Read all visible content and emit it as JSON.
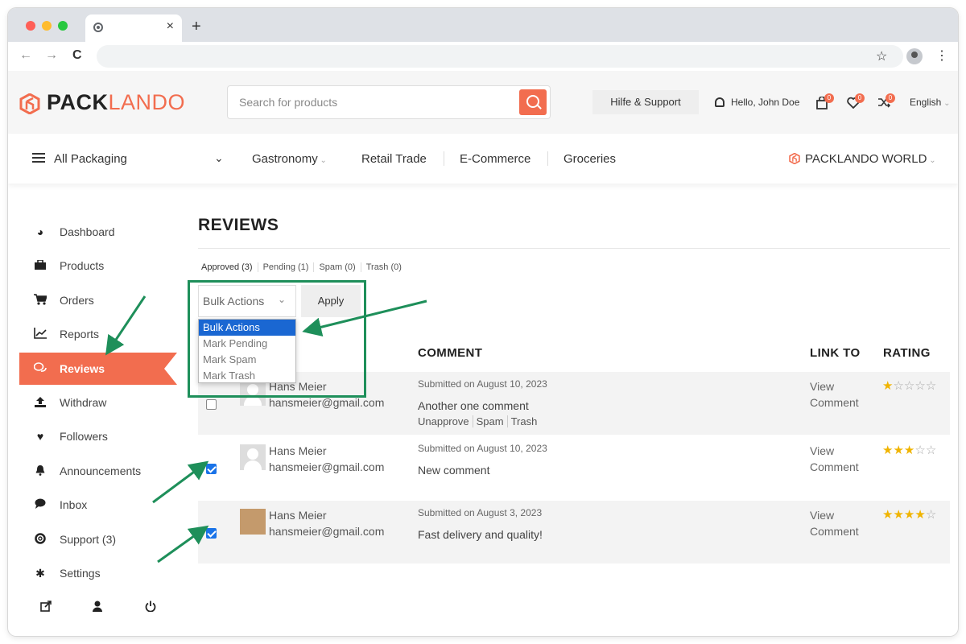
{
  "browser": {
    "tab_close": "×",
    "new_tab": "+",
    "back": "←",
    "forward": "→",
    "reload": "C",
    "bookmark": "☆",
    "menu": "⋮"
  },
  "header": {
    "logo_pack": "PACK",
    "logo_lando": "LANDO",
    "search_placeholder": "Search for products",
    "help_label": "Hilfe & Support",
    "greeting": "Hello, John Doe",
    "cart_count": "0",
    "wishlist_count": "0",
    "compare_count": "0",
    "language": "English"
  },
  "catbar": {
    "all_label": "All Packaging",
    "categories": [
      "Gastronomy",
      "Retail Trade",
      "E-Commerce",
      "Groceries"
    ],
    "world_label": "PACKLANDO WORLD"
  },
  "sidebar": {
    "items": [
      {
        "label": "Dashboard",
        "icon": "dashboard-icon"
      },
      {
        "label": "Products",
        "icon": "briefcase-icon"
      },
      {
        "label": "Orders",
        "icon": "cart-icon"
      },
      {
        "label": "Reports",
        "icon": "chart-icon"
      },
      {
        "label": "Reviews",
        "icon": "reviews-icon"
      },
      {
        "label": "Withdraw",
        "icon": "upload-icon"
      },
      {
        "label": "Followers",
        "icon": "heart-icon"
      },
      {
        "label": "Announcements",
        "icon": "bell-icon"
      },
      {
        "label": "Inbox",
        "icon": "chat-icon"
      },
      {
        "label": "Support (3)",
        "icon": "lifebuoy-icon"
      },
      {
        "label": "Settings",
        "icon": "gear-icon"
      }
    ],
    "active_index": 4
  },
  "reviews": {
    "title": "REVIEWS",
    "filters": [
      "Approved (3)",
      "Pending (1)",
      "Spam (0)",
      "Trash (0)"
    ],
    "bulk_selected": "Bulk Actions",
    "apply_label": "Apply",
    "bulk_options": [
      "Bulk Actions",
      "Mark Pending",
      "Mark Spam",
      "Mark Trash"
    ],
    "columns": {
      "comment": "COMMENT",
      "link_to": "LINK TO",
      "rating": "RATING"
    },
    "rows": [
      {
        "name": "Hans Meier",
        "email": "hansmeier@gmail.com",
        "submitted": "Submitted on August 10, 2023",
        "comment": "Another one comment",
        "actions": [
          "Unapprove",
          "Spam",
          "Trash"
        ],
        "link1": "View",
        "link2": "Comment",
        "rating": 1,
        "checked": false
      },
      {
        "name": "Hans Meier",
        "email": "hansmeier@gmail.com",
        "submitted": "Submitted on August 10, 2023",
        "comment": "New comment",
        "actions": [],
        "link1": "View",
        "link2": "Comment",
        "rating": 3,
        "checked": true
      },
      {
        "name": "Hans Meier",
        "email": "hansmeier@gmail.com",
        "submitted": "Submitted on August 3, 2023",
        "comment": "Fast delivery and quality!",
        "actions": [],
        "link1": "View",
        "link2": "Comment",
        "rating": 4,
        "checked": true
      }
    ]
  },
  "colors": {
    "accent": "#f26d4f",
    "annotation": "#1e8f5a",
    "star": "#f0b400"
  }
}
